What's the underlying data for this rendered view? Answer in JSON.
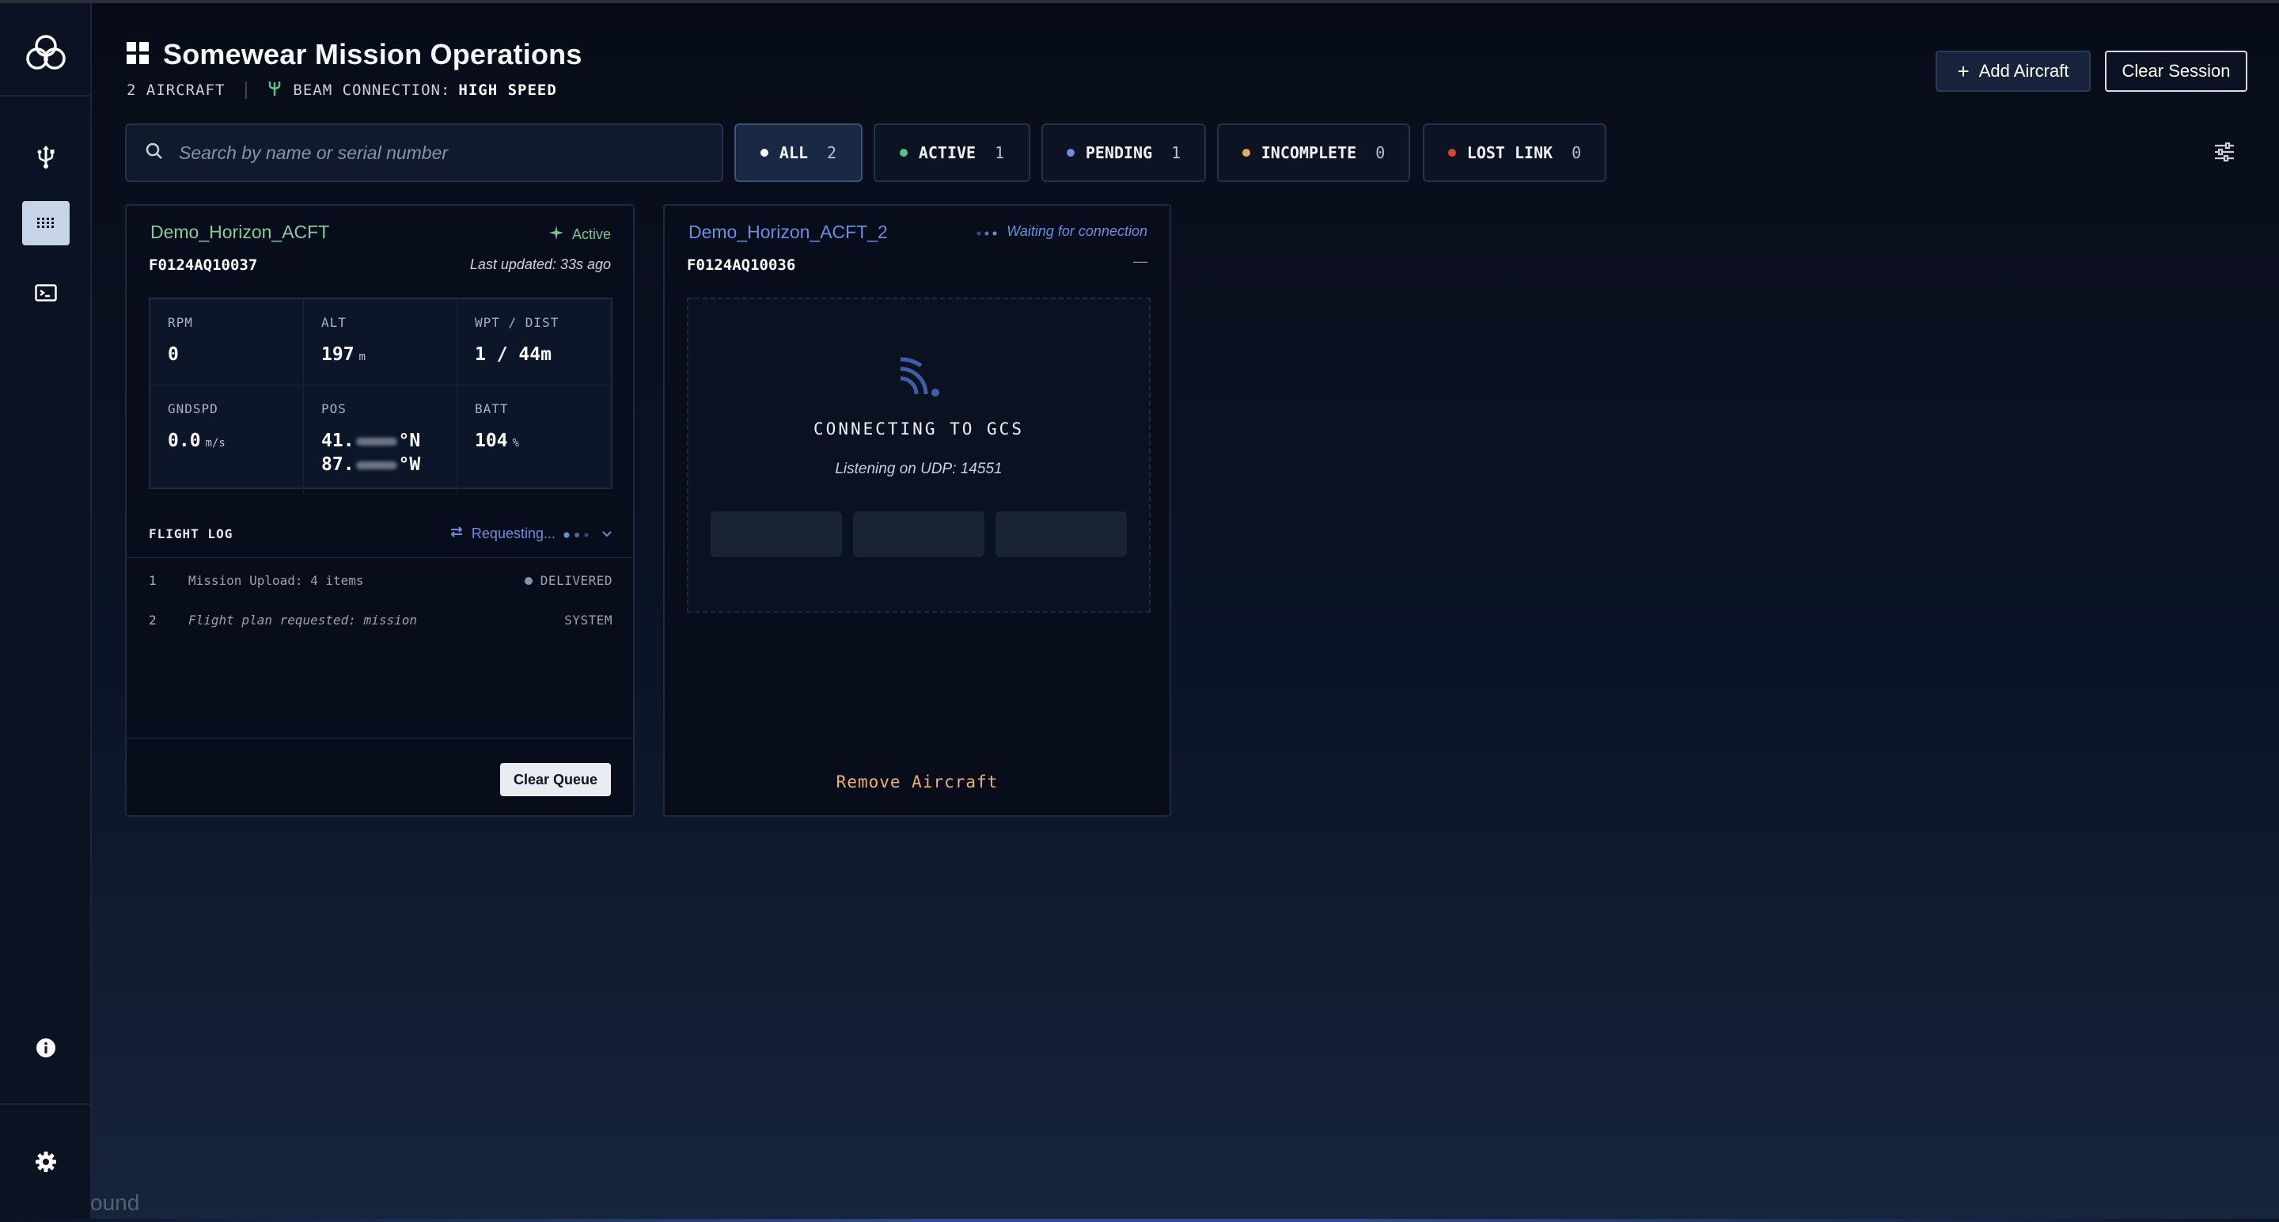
{
  "app": {
    "title": "Somewear Mission Operations",
    "aircraft_count": "2 AIRCRAFT",
    "beam_label": "BEAM CONNECTION:",
    "beam_value": "HIGH SPEED"
  },
  "header_buttons": {
    "add": "Add Aircraft",
    "clear": "Clear Session"
  },
  "sidebar": {
    "items": [
      "logo-icon",
      "usb-icon",
      "grid-icon",
      "terminal-icon",
      "info-icon",
      "gear-icon"
    ],
    "active": "grid-icon"
  },
  "search": {
    "placeholder": "Search by name or serial number"
  },
  "filters": [
    {
      "label": "ALL",
      "count": "2",
      "color": "#ffffff",
      "selected": true
    },
    {
      "label": "ACTIVE",
      "count": "1",
      "color": "#5fbf86"
    },
    {
      "label": "PENDING",
      "count": "1",
      "color": "#6f8ddb"
    },
    {
      "label": "INCOMPLETE",
      "count": "0",
      "color": "#e8a86a"
    },
    {
      "label": "LOST LINK",
      "count": "0",
      "color": "#d9453b"
    }
  ],
  "card1": {
    "name": "Demo_Horizon_ACFT",
    "serial": "F0124AQ10037",
    "status": "Active",
    "updated": "Last updated: 33s ago",
    "telemetry": {
      "rpm_label": "RPM",
      "rpm": "0",
      "alt_label": "ALT",
      "alt": "197",
      "alt_unit": "m",
      "wpt_label": "WPT / DIST",
      "wpt": "1 / 44m",
      "gndspd_label": "GNDSPD",
      "gndspd": "0.0",
      "gndspd_unit": "m/s",
      "pos_label": "POS",
      "lat_prefix": "41.",
      "lat_suffix": "°N",
      "lon_prefix": "87.",
      "lon_suffix": "°W",
      "batt_label": "BATT",
      "batt": "104",
      "batt_unit": "%"
    },
    "flight_log": {
      "title": "FLIGHT LOG",
      "status": "Requesting...",
      "rows": [
        {
          "idx": "1",
          "text": "Mission Upload: 4 items",
          "tag": "DELIVERED"
        },
        {
          "idx": "2",
          "text": "Flight plan requested: mission",
          "tag": "SYSTEM"
        }
      ]
    },
    "clear_queue": "Clear Queue"
  },
  "card2": {
    "name": "Demo_Horizon_ACFT_2",
    "serial": "F0124AQ10036",
    "status": "Waiting for connection",
    "dash": "—",
    "connecting": "CONNECTING TO GCS",
    "listening": "Listening on UDP: 14551",
    "remove": "Remove Aircraft"
  },
  "ghost_text": "ound",
  "colors": {
    "accent": "#6f8ddb",
    "active": "#76c893",
    "remove": "#e8b27a"
  }
}
